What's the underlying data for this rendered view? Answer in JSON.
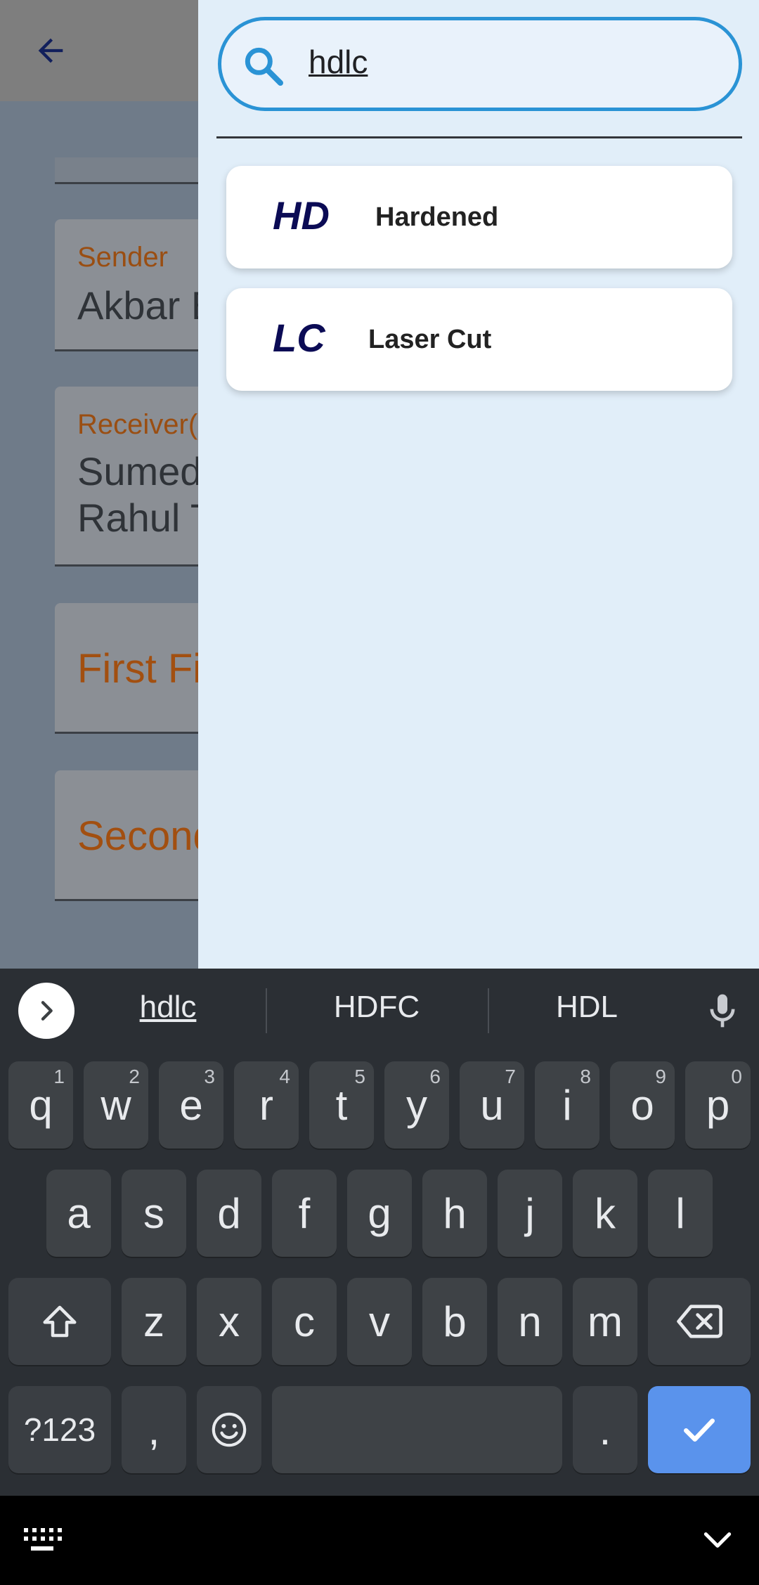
{
  "background": {
    "sender": {
      "label": "Sender",
      "value": "Akbar B"
    },
    "receiver": {
      "label": "Receiver(",
      "value": "Sumed\nRahul T"
    },
    "first_field": {
      "placeholder": "First Fi"
    },
    "second_field": {
      "placeholder": "Second"
    }
  },
  "search": {
    "query": "hdlc",
    "results": [
      {
        "code": "HD",
        "name": "Hardened"
      },
      {
        "code": "LC",
        "name": "Laser Cut"
      }
    ]
  },
  "keyboard": {
    "suggestions": [
      "hdlc",
      "HDFC",
      "HDL"
    ],
    "row1": [
      {
        "k": "q",
        "h": "1"
      },
      {
        "k": "w",
        "h": "2"
      },
      {
        "k": "e",
        "h": "3"
      },
      {
        "k": "r",
        "h": "4"
      },
      {
        "k": "t",
        "h": "5"
      },
      {
        "k": "y",
        "h": "6"
      },
      {
        "k": "u",
        "h": "7"
      },
      {
        "k": "i",
        "h": "8"
      },
      {
        "k": "o",
        "h": "9"
      },
      {
        "k": "p",
        "h": "0"
      }
    ],
    "row2": [
      "a",
      "s",
      "d",
      "f",
      "g",
      "h",
      "j",
      "k",
      "l"
    ],
    "row3": [
      "z",
      "x",
      "c",
      "v",
      "b",
      "n",
      "m"
    ],
    "symbols_label": "?123",
    "comma_label": ",",
    "period_label": "."
  },
  "colors": {
    "accent": "#2a93d5",
    "field_label": "#9a4e12",
    "enter_key": "#5a93ec"
  }
}
